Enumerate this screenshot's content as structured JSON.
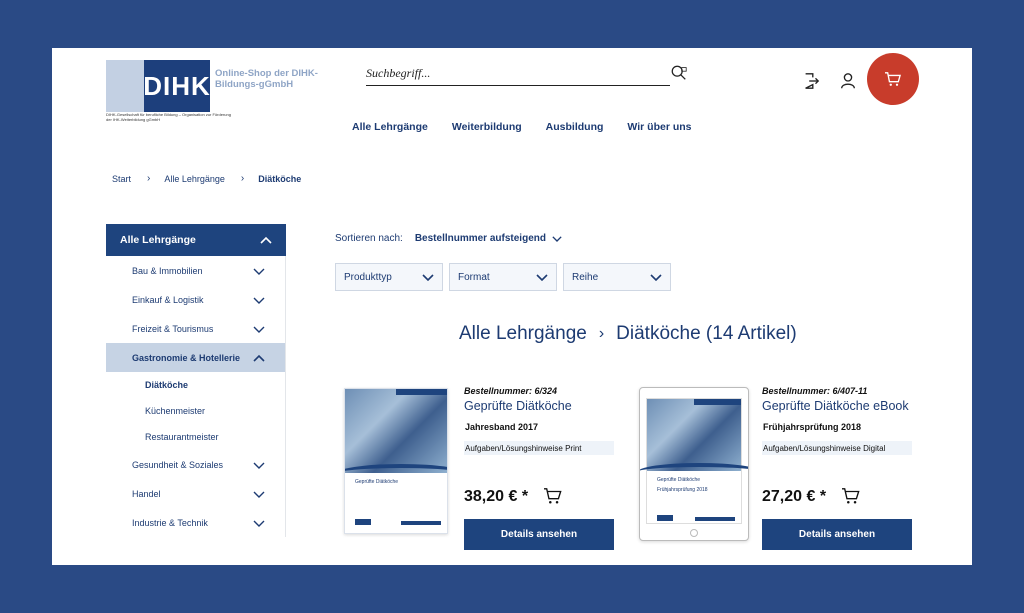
{
  "header": {
    "logo_text": "DIHK",
    "logo_title": "Online-Shop der DIHK-Bildungs-gGmbH",
    "logo_sub": "DIHK-Gesellschaft für berufliche Bildung – Organisation zur Förderung der IHK-Weiterbildung gGmbH",
    "search_placeholder": "Suchbegriff..."
  },
  "nav": [
    "Alle Lehrgänge",
    "Weiterbildung",
    "Ausbildung",
    "Wir über uns"
  ],
  "breadcrumb": [
    "Start",
    "Alle Lehrgänge",
    "Diätköche"
  ],
  "sidebar": {
    "title": "Alle Lehrgänge",
    "items": [
      {
        "label": "Bau & Immobilien"
      },
      {
        "label": "Einkauf & Logistik"
      },
      {
        "label": "Freizeit & Tourismus"
      },
      {
        "label": "Gastronomie & Hotellerie"
      },
      {
        "label": "Diätköche"
      },
      {
        "label": "Küchenmeister"
      },
      {
        "label": "Restaurantmeister"
      },
      {
        "label": "Gesundheit & Soziales"
      },
      {
        "label": "Handel"
      },
      {
        "label": "Industrie & Technik"
      }
    ]
  },
  "sort": {
    "label": "Sortieren nach:",
    "value": "Bestellnummer aufsteigend"
  },
  "filters": [
    "Produkttyp",
    "Format",
    "Reihe"
  ],
  "list_title": {
    "parent": "Alle Lehrgänge",
    "current": "Diätköche (14 Artikel)"
  },
  "products": [
    {
      "number": "Bestellnummer: 6/324",
      "name": "Geprüfte Diätköche",
      "volume": "Jahresband 2017",
      "type": "Aufgaben/Lösungshinweise Print",
      "price": "38,20 € *",
      "button": "Details ansehen",
      "cover_title": "Geprüfte Diätköche",
      "cover_sub": ""
    },
    {
      "number": "Bestellnummer: 6/407-11",
      "name": "Geprüfte Diätköche eBook",
      "volume": "Frühjahrsprüfung 2018",
      "type": "Aufgaben/Lösungshinweise Digital",
      "price": "27,20 € *",
      "button": "Details ansehen",
      "cover_title": "Geprüfte Diätköche",
      "cover_sub": "Frühjahrsprüfung 2018"
    }
  ],
  "colors": {
    "frame": "#2a4a85",
    "primary": "#1e447e",
    "cart": "#c83c2b",
    "active": "#c6d3e4"
  }
}
